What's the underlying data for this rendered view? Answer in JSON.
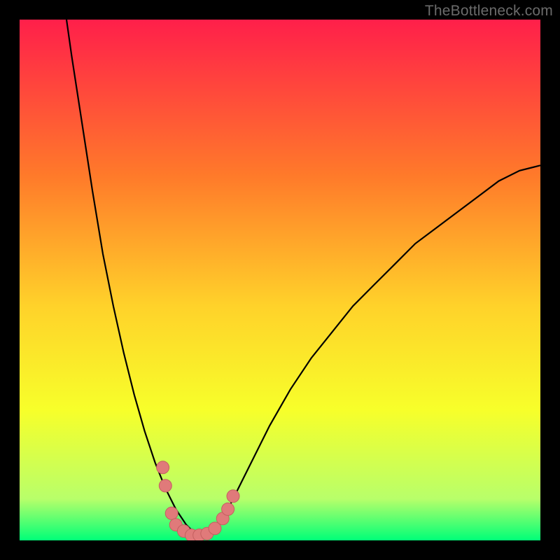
{
  "watermark": "TheBottleneck.com",
  "colors": {
    "grad_top": "#ff1f4a",
    "grad_mid1": "#ff7a2a",
    "grad_mid2": "#ffd22a",
    "grad_mid3": "#f7ff2a",
    "grad_mid4": "#b8ff6a",
    "grad_bot": "#00ff78",
    "curve": "#000000",
    "marker_fill": "#e07a7a",
    "marker_stroke": "#c46060",
    "frame": "#000000"
  },
  "chart_data": {
    "type": "line",
    "title": "",
    "xlabel": "",
    "ylabel": "",
    "xlim": [
      0,
      100
    ],
    "ylim": [
      0,
      100
    ],
    "curve": {
      "minimum_x": 34,
      "left_branch_x_at_top": 9,
      "right_branch_x_at_y72": 100,
      "points_x": [
        0,
        2,
        4,
        6,
        8,
        9,
        10,
        12,
        14,
        16,
        18,
        20,
        22,
        24,
        26,
        28,
        30,
        32,
        34,
        36,
        38,
        40,
        42,
        44,
        46,
        48,
        52,
        56,
        60,
        64,
        68,
        72,
        76,
        80,
        84,
        88,
        92,
        96,
        100
      ],
      "points_y": [
        null,
        null,
        null,
        null,
        null,
        100,
        93,
        80,
        67,
        55,
        45,
        36,
        28,
        21,
        15,
        10,
        6,
        3,
        1,
        1,
        3,
        6,
        10,
        14,
        18,
        22,
        29,
        35,
        40,
        45,
        49,
        53,
        57,
        60,
        63,
        66,
        69,
        71,
        72
      ]
    },
    "markers": [
      {
        "x": 27.5,
        "y": 14.0
      },
      {
        "x": 28.0,
        "y": 10.5
      },
      {
        "x": 29.2,
        "y": 5.2
      },
      {
        "x": 30.0,
        "y": 3.0
      },
      {
        "x": 31.5,
        "y": 1.8
      },
      {
        "x": 33.0,
        "y": 1.0
      },
      {
        "x": 34.5,
        "y": 1.0
      },
      {
        "x": 36.0,
        "y": 1.3
      },
      {
        "x": 37.5,
        "y": 2.3
      },
      {
        "x": 39.0,
        "y": 4.2
      },
      {
        "x": 40.0,
        "y": 6.0
      },
      {
        "x": 41.0,
        "y": 8.5
      }
    ]
  }
}
